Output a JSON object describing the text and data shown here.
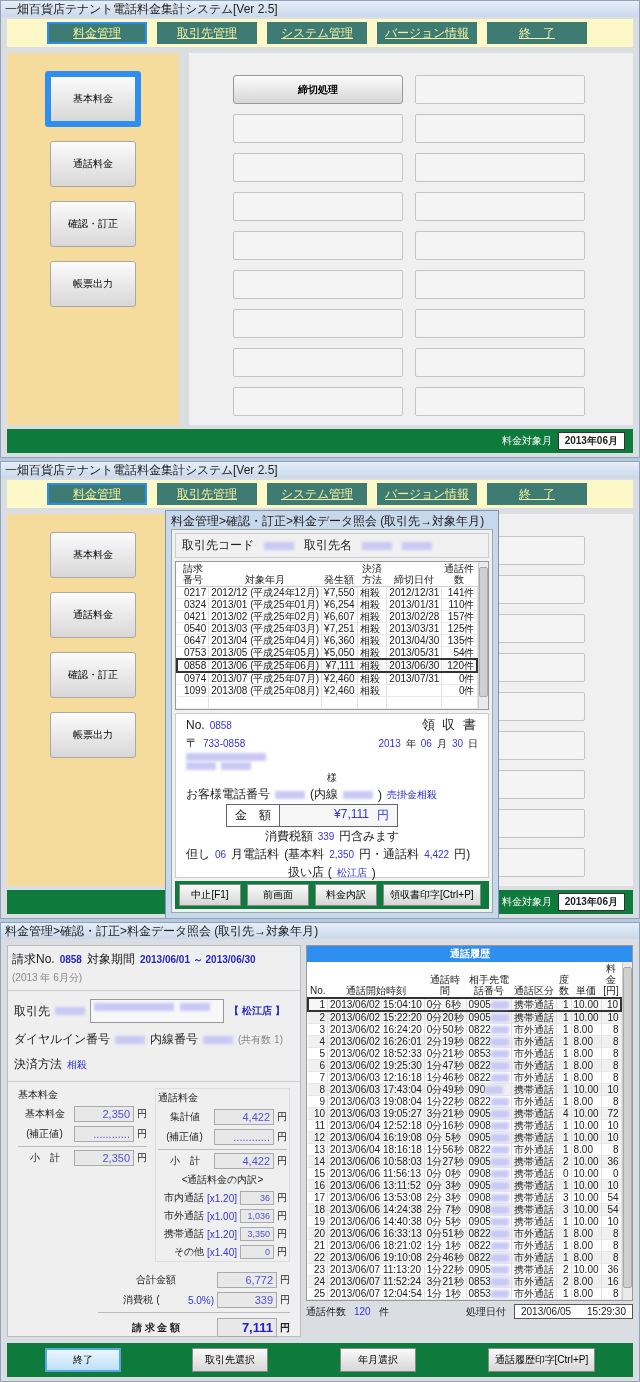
{
  "screens": [
    {
      "title": "一畑百貨店テナント電話料金集計システム[Ver 2.5]",
      "menu": [
        {
          "label": "料金管理",
          "selected": true
        },
        {
          "label": "取引先管理",
          "selected": false
        },
        {
          "label": "システム管理",
          "selected": false
        },
        {
          "label": "バージョン情報",
          "selected": false
        },
        {
          "label": "終　了",
          "selected": false
        }
      ],
      "sidebar": [
        {
          "label": "基本料金",
          "selected": true
        },
        {
          "label": "通話料金",
          "selected": false
        },
        {
          "label": "確認・訂正",
          "selected": false
        },
        {
          "label": "帳票出力",
          "selected": false
        }
      ],
      "action_buttons": [
        "締切処理"
      ],
      "status_label": "料金対象月",
      "status_value": "2013年06月"
    },
    {
      "title": "一畑百貨店テナント電話料金集計システム[Ver 2.5]",
      "menu": [
        {
          "label": "料金管理",
          "selected": true
        },
        {
          "label": "取引先管理",
          "selected": false
        },
        {
          "label": "システム管理",
          "selected": false
        },
        {
          "label": "バージョン情報",
          "selected": false
        },
        {
          "label": "終　了",
          "selected": false
        }
      ],
      "sidebar": [
        {
          "label": "基本料金",
          "selected": false
        },
        {
          "label": "通話料金",
          "selected": false
        },
        {
          "label": "確認・訂正",
          "selected": false
        },
        {
          "label": "帳票出力",
          "selected": false
        }
      ],
      "status_label": "料金対象月",
      "status_value": "2013年06月",
      "dialog": {
        "title": "料金管理>確認・訂正>料金データ照会 (取引先→対象年月)",
        "head": [
          {
            "kind": "label",
            "text": "取引先コード"
          },
          {
            "kind": "redacted"
          },
          {
            "kind": "label",
            "text": "取引先名"
          },
          {
            "kind": "redacted"
          },
          {
            "kind": "redacted"
          }
        ],
        "columns": [
          "請求番号",
          "対象年月",
          "発生額",
          "決済方法",
          "締切日付",
          "通話件数"
        ],
        "rows": [
          {
            "no": "0217",
            "month": "2012/12 (平成24年12月)",
            "amount": "¥7,550",
            "method": "相殺",
            "closing": "2012/12/31",
            "calls": "141件",
            "selected": false
          },
          {
            "no": "0324",
            "month": "2013/01 (平成25年01月)",
            "amount": "¥6,254",
            "method": "相殺",
            "closing": "2013/01/31",
            "calls": "110件",
            "selected": false
          },
          {
            "no": "0421",
            "month": "2013/02 (平成25年02月)",
            "amount": "¥6,607",
            "method": "相殺",
            "closing": "2013/02/28",
            "calls": "157件",
            "selected": false
          },
          {
            "no": "0540",
            "month": "2013/03 (平成25年03月)",
            "amount": "¥7,251",
            "method": "相殺",
            "closing": "2013/03/31",
            "calls": "125件",
            "selected": false
          },
          {
            "no": "0647",
            "month": "2013/04 (平成25年04月)",
            "amount": "¥6,360",
            "method": "相殺",
            "closing": "2013/04/30",
            "calls": "135件",
            "selected": false
          },
          {
            "no": "0753",
            "month": "2013/05 (平成25年05月)",
            "amount": "¥5,050",
            "method": "相殺",
            "closing": "2013/05/31",
            "calls": "54件",
            "selected": false
          },
          {
            "no": "0858",
            "month": "2013/06 (平成25年06月)",
            "amount": "¥7,111",
            "method": "相殺",
            "closing": "2013/06/30",
            "calls": "120件",
            "selected": true
          },
          {
            "no": "0974",
            "month": "2013/07 (平成25年07月)",
            "amount": "¥2,460",
            "method": "相殺",
            "closing": "2013/07/31",
            "calls": "0件",
            "selected": false
          },
          {
            "no": "1099",
            "month": "2013/08 (平成25年08月)",
            "amount": "¥2,460",
            "method": "相殺",
            "closing": "",
            "calls": "0件",
            "selected": false
          }
        ],
        "receipt": {
          "no": [
            {
              "kind": "label",
              "text": "No."
            },
            {
              "kind": "value",
              "text": "0858"
            }
          ],
          "title": "領 収 書",
          "postal": [
            {
              "kind": "label",
              "text": "〒"
            },
            {
              "kind": "value",
              "text": "733-0858"
            }
          ],
          "date": [
            "2013",
            "年",
            "06",
            "月",
            "30",
            "日"
          ],
          "honorific": "様",
          "phone": [
            {
              "kind": "label",
              "text": "お客様電話番号"
            },
            {
              "kind": "redacted"
            },
            {
              "kind": "label",
              "text": "(内線"
            },
            {
              "kind": "redacted"
            },
            {
              "kind": "label",
              "text": ")"
            },
            {
              "kind": "link",
              "text": "売掛金相殺"
            }
          ],
          "amount_label": "金　額",
          "amount": "¥7,111",
          "amount_unit": "円",
          "tax": [
            {
              "kind": "label",
              "text": "消費税額"
            },
            {
              "kind": "value",
              "text": "339"
            },
            {
              "kind": "label",
              "text": "円含みます"
            }
          ],
          "detail": [
            {
              "kind": "label",
              "text": "但し"
            },
            {
              "kind": "value",
              "text": "06"
            },
            {
              "kind": "label",
              "text": "月電話料"
            },
            {
              "kind": "label",
              "text": "(基本料"
            },
            {
              "kind": "value",
              "text": "2,350"
            },
            {
              "kind": "label",
              "text": "円・通話料"
            },
            {
              "kind": "value",
              "text": "4,422"
            },
            {
              "kind": "label",
              "text": "円)"
            }
          ],
          "store": [
            {
              "kind": "label",
              "text": "扱い店 ("
            },
            {
              "kind": "link",
              "text": "松江店"
            },
            {
              "kind": "label",
              "text": ")"
            }
          ]
        },
        "buttons": [
          "中止[F1]",
          "前画面",
          "料金内訳",
          "領収書印字[Ctrl+P]"
        ]
      }
    }
  ],
  "detail": {
    "title": "料金管理>確認・訂正>料金データ照会 (取引先→対象年月)",
    "header": [
      {
        "kind": "label",
        "text": "請求No."
      },
      {
        "kind": "strong",
        "text": "0858"
      },
      {
        "kind": "label",
        "text": "対象期間"
      },
      {
        "kind": "strong",
        "text": "2013/06/01 ～ 2013/06/30"
      },
      {
        "kind": "note",
        "text": "(2013 年 6月分)"
      }
    ],
    "client": [
      [
        {
          "kind": "label",
          "text": "取引先"
        },
        {
          "kind": "redacted"
        },
        {
          "kind": "textbox"
        },
        {
          "kind": "strong",
          "text": "【 松江店 】"
        }
      ],
      [
        {
          "kind": "label",
          "text": "ダイヤルイン番号"
        },
        {
          "kind": "redacted"
        },
        {
          "kind": "label",
          "text": "内線番号"
        },
        {
          "kind": "redacted"
        },
        {
          "kind": "note",
          "text": "(共有数 1)"
        }
      ],
      [
        {
          "kind": "label",
          "text": "決済方法"
        },
        {
          "kind": "value",
          "text": "相殺"
        }
      ]
    ],
    "basic": {
      "title": "基本料金",
      "rows": [
        {
          "kind": "entry",
          "label": "基本料金",
          "value": "2,350",
          "unit": "円"
        },
        {
          "kind": "entry",
          "label": "(補正値)",
          "value": "............",
          "unit": "円"
        },
        {
          "kind": "subtotal",
          "label": "小　計",
          "value": "2,350",
          "unit": "円"
        }
      ]
    },
    "call": {
      "title": "通話料金",
      "rows": [
        {
          "kind": "entry",
          "label": "集計値",
          "value": "4,422",
          "unit": "円"
        },
        {
          "kind": "entry",
          "label": "(補正値)",
          "value": "............",
          "unit": "円"
        },
        {
          "kind": "subtotal",
          "label": "小　計",
          "value": "4,422",
          "unit": "円"
        }
      ],
      "breakdown_title": "<通話料金の内訳>",
      "breakdown": [
        {
          "label": "市内通話",
          "rate": "[x1.20]",
          "value": "36",
          "unit": "円"
        },
        {
          "label": "市外通話",
          "rate": "[x1.00]",
          "value": "1,036",
          "unit": "円"
        },
        {
          "label": "携帯通話",
          "rate": "[x1.20]",
          "value": "3,350",
          "unit": "円"
        },
        {
          "label": "その他",
          "rate": "[x1.40]",
          "value": "0",
          "unit": "円"
        }
      ]
    },
    "totals": [
      {
        "kind": "entry",
        "label": "合計金額",
        "value": "6,772",
        "unit": "円"
      },
      {
        "kind": "entry",
        "label": "消費税 (",
        "rate": "5.0%)",
        "value": "339",
        "unit": "円"
      },
      {
        "kind": "grand",
        "label": "請 求 金 額",
        "value": "7,111",
        "unit": "円"
      }
    ],
    "calls": {
      "title": "通話履歴",
      "columns": [
        "No.",
        "通話開始時刻",
        "通話時間",
        "相手先電話番号",
        "通話区分",
        "度数",
        "単価",
        "料金[円]"
      ],
      "rows": [
        {
          "no": "1",
          "start": "2013/06/02 15:04:10",
          "duration": "0分 6秒",
          "phone": "0905",
          "type": "携帯通話",
          "count": "1",
          "rate": "10.00",
          "fee": "10",
          "selected": true
        },
        {
          "no": "2",
          "start": "2013/06/02 15:22:20",
          "duration": "0分20秒",
          "phone": "0905",
          "type": "携帯通話",
          "count": "1",
          "rate": "10.00",
          "fee": "10",
          "selected": false
        },
        {
          "no": "3",
          "start": "2013/06/02 16:24:20",
          "duration": "0分50秒",
          "phone": "0822",
          "type": "市外通話",
          "count": "1",
          "rate": "8.00",
          "fee": "8",
          "selected": false
        },
        {
          "no": "4",
          "start": "2013/06/02 16:26:01",
          "duration": "2分19秒",
          "phone": "0822",
          "type": "市外通話",
          "count": "1",
          "rate": "8.00",
          "fee": "8",
          "selected": false
        },
        {
          "no": "5",
          "start": "2013/06/02 18:52:33",
          "duration": "0分21秒",
          "phone": "0853",
          "type": "市外通話",
          "count": "1",
          "rate": "8.00",
          "fee": "8",
          "selected": false
        },
        {
          "no": "6",
          "start": "2013/06/02 19:25:30",
          "duration": "1分47秒",
          "phone": "0822",
          "type": "市外通話",
          "count": "1",
          "rate": "8.00",
          "fee": "8",
          "selected": false
        },
        {
          "no": "7",
          "start": "2013/06/03 12:16:18",
          "duration": "1分46秒",
          "phone": "0822",
          "type": "市外通話",
          "count": "1",
          "rate": "8.00",
          "fee": "8",
          "selected": false
        },
        {
          "no": "8",
          "start": "2013/06/03 17:43:04",
          "duration": "0分49秒",
          "phone": "090",
          "type": "携帯通話",
          "count": "1",
          "rate": "10.00",
          "fee": "10",
          "selected": false
        },
        {
          "no": "9",
          "start": "2013/06/03 19:08:04",
          "duration": "1分22秒",
          "phone": "0822",
          "type": "市外通話",
          "count": "1",
          "rate": "8.00",
          "fee": "8",
          "selected": false
        },
        {
          "no": "10",
          "start": "2013/06/03 19:05:27",
          "duration": "3分21秒",
          "phone": "0905",
          "type": "携帯通話",
          "count": "4",
          "rate": "10.00",
          "fee": "72",
          "selected": false
        },
        {
          "no": "11",
          "start": "2013/06/04 12:52:18",
          "duration": "0分16秒",
          "phone": "0908",
          "type": "携帯通話",
          "count": "1",
          "rate": "10.00",
          "fee": "10",
          "selected": false
        },
        {
          "no": "12",
          "start": "2013/06/04 16:19:08",
          "duration": "0分 5秒",
          "phone": "0905",
          "type": "携帯通話",
          "count": "1",
          "rate": "10.00",
          "fee": "10",
          "selected": false
        },
        {
          "no": "13",
          "start": "2013/06/04 18:16:18",
          "duration": "1分56秒",
          "phone": "0822",
          "type": "市外通話",
          "count": "1",
          "rate": "8.00",
          "fee": "8",
          "selected": false
        },
        {
          "no": "14",
          "start": "2013/06/06 10:58:03",
          "duration": "1分27秒",
          "phone": "0905",
          "type": "携帯通話",
          "count": "2",
          "rate": "10.00",
          "fee": "36",
          "selected": false
        },
        {
          "no": "15",
          "start": "2013/06/06 11:56:13",
          "duration": "0分 0秒",
          "phone": "0908",
          "type": "携帯通話",
          "count": "0",
          "rate": "10.00",
          "fee": "0",
          "selected": false
        },
        {
          "no": "16",
          "start": "2013/06/06 13:11:52",
          "duration": "0分 3秒",
          "phone": "0905",
          "type": "携帯通話",
          "count": "1",
          "rate": "10.00",
          "fee": "10",
          "selected": false
        },
        {
          "no": "17",
          "start": "2013/06/06 13:53:08",
          "duration": "2分 3秒",
          "phone": "0908",
          "type": "携帯通話",
          "count": "3",
          "rate": "10.00",
          "fee": "54",
          "selected": false
        },
        {
          "no": "18",
          "start": "2013/06/06 14:24:38",
          "duration": "2分 7秒",
          "phone": "0908",
          "type": "携帯通話",
          "count": "3",
          "rate": "10.00",
          "fee": "54",
          "selected": false
        },
        {
          "no": "19",
          "start": "2013/06/06 14:40:38",
          "duration": "0分 5秒",
          "phone": "0905",
          "type": "携帯通話",
          "count": "1",
          "rate": "10.00",
          "fee": "10",
          "selected": false
        },
        {
          "no": "20",
          "start": "2013/06/06 16:33:13",
          "duration": "0分51秒",
          "phone": "0822",
          "type": "市外通話",
          "count": "1",
          "rate": "8.00",
          "fee": "8",
          "selected": false
        },
        {
          "no": "21",
          "start": "2013/06/06 18:21:02",
          "duration": "1分 1秒",
          "phone": "0822",
          "type": "市外通話",
          "count": "1",
          "rate": "8.00",
          "fee": "8",
          "selected": false
        },
        {
          "no": "22",
          "start": "2013/06/06 19:10:08",
          "duration": "2分46秒",
          "phone": "0822",
          "type": "市外通話",
          "count": "1",
          "rate": "8.00",
          "fee": "8",
          "selected": false
        },
        {
          "no": "23",
          "start": "2013/06/07 11:13:20",
          "duration": "1分22秒",
          "phone": "0905",
          "type": "携帯通話",
          "count": "2",
          "rate": "10.00",
          "fee": "36",
          "selected": false
        },
        {
          "no": "24",
          "start": "2013/06/07 11:52:24",
          "duration": "3分21秒",
          "phone": "0853",
          "type": "市外通話",
          "count": "2",
          "rate": "8.00",
          "fee": "16",
          "selected": false
        },
        {
          "no": "25",
          "start": "2013/06/07 12:04:54",
          "duration": "1分 1秒",
          "phone": "0853",
          "type": "市外通話",
          "count": "1",
          "rate": "8.00",
          "fee": "8",
          "selected": false
        }
      ],
      "count_label": "通話件数",
      "count": "120",
      "count_unit": "件",
      "date_label": "処理日付",
      "date": "2013/06/05",
      "time": "15:29:30"
    },
    "buttons": [
      {
        "label": "終了",
        "focused": true
      },
      {
        "label": "取引先選択",
        "focused": false
      },
      {
        "label": "年月選択",
        "focused": false
      },
      {
        "label": "通話履歴印字[Ctrl+P]",
        "focused": false
      }
    ]
  }
}
